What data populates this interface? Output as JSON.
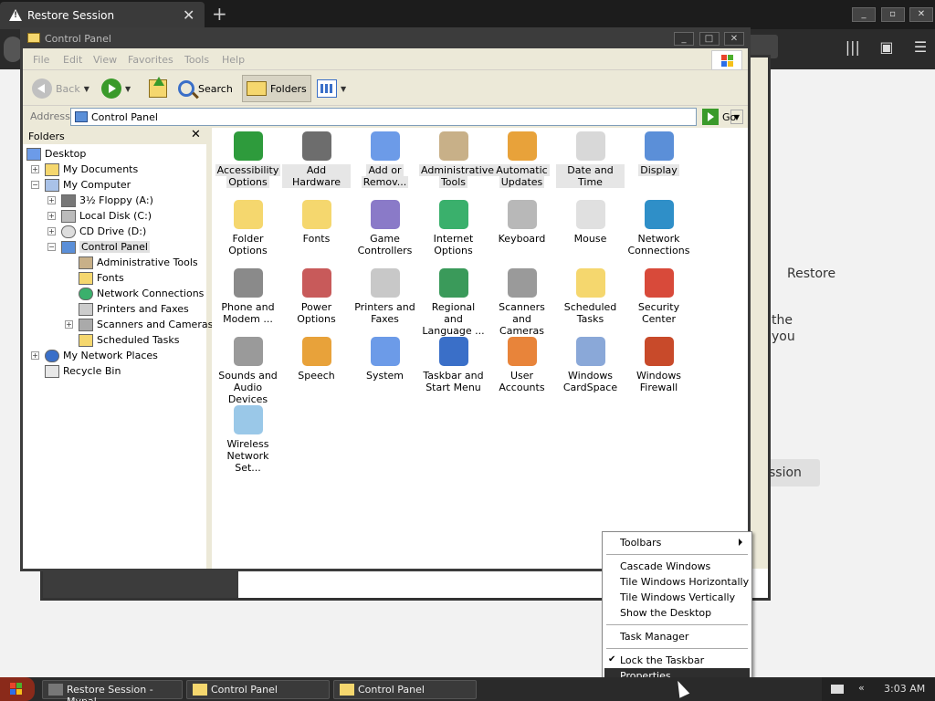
{
  "browser": {
    "tab_title": "Restore Session",
    "new_tab_symbol": "+",
    "close_symbol": "✕",
    "window_controls": [
      "_",
      "▫",
      "✕"
    ],
    "bg_text": [
      "Restore",
      "the",
      "you",
      "ssion"
    ]
  },
  "cp_back": {
    "title": "Control Panel"
  },
  "cp": {
    "title": "Control Panel",
    "title_buttons": [
      "_",
      "□",
      "✕"
    ],
    "menu": [
      "File",
      "Edit",
      "View",
      "Favorites",
      "Tools",
      "Help"
    ],
    "toolbar": {
      "back": "Back",
      "search": "Search",
      "folders": "Folders"
    },
    "address": {
      "label": "Address",
      "value": "Control Panel",
      "go": "Go"
    },
    "folders_pane": {
      "title": "Folders",
      "close": "✕",
      "tree": [
        {
          "label": "Desktop",
          "icon": "desktop-icon"
        },
        {
          "label": "My Documents",
          "icon": "my-documents-icon"
        },
        {
          "label": "My Computer",
          "icon": "my-computer-icon"
        },
        {
          "label": "3½ Floppy (A:)",
          "icon": "floppy-icon"
        },
        {
          "label": "Local Disk (C:)",
          "icon": "local-disk-icon"
        },
        {
          "label": "CD Drive (D:)",
          "icon": "cd-drive-icon"
        },
        {
          "label": "Control Panel",
          "icon": "control-panel-icon"
        },
        {
          "label": "Administrative Tools",
          "icon": "administrative-tools-icon"
        },
        {
          "label": "Fonts",
          "icon": "fonts-folder-icon"
        },
        {
          "label": "Network Connections",
          "icon": "network-connections-icon"
        },
        {
          "label": "Printers and Faxes",
          "icon": "printer-icon"
        },
        {
          "label": "Scanners and Cameras",
          "icon": "scanner-icon"
        },
        {
          "label": "Scheduled Tasks",
          "icon": "scheduled-tasks-icon"
        },
        {
          "label": "My Network Places",
          "icon": "network-places-icon"
        },
        {
          "label": "Recycle Bin",
          "icon": "recycle-bin-icon"
        }
      ]
    },
    "items": [
      {
        "label1": "Accessibility",
        "label2": "Options",
        "icon": "accessibility-icon",
        "color": "#2e9b3c"
      },
      {
        "label1": "Add Hardware",
        "label2": "",
        "icon": "add-hardware-icon",
        "color": "#6d6d6d"
      },
      {
        "label1": "Add or",
        "label2": "Remov...",
        "icon": "add-remove-programs-icon",
        "color": "#6c9be8"
      },
      {
        "label1": "Administrative",
        "label2": "Tools",
        "icon": "administrative-tools-icon",
        "color": "#c8b088"
      },
      {
        "label1": "Automatic",
        "label2": "Updates",
        "icon": "automatic-updates-icon",
        "color": "#e8a23a"
      },
      {
        "label1": "Date and Time",
        "label2": "",
        "icon": "date-time-icon",
        "color": "#d8d8d8"
      },
      {
        "label1": "Display",
        "label2": "",
        "icon": "display-icon",
        "color": "#5b8fd8"
      },
      {
        "label1": "Folder Options",
        "label2": "",
        "icon": "folder-options-icon",
        "color": "#f5d76e"
      },
      {
        "label1": "Fonts",
        "label2": "",
        "icon": "fonts-icon",
        "color": "#f5d76e"
      },
      {
        "label1": "Game",
        "label2": "Controllers",
        "icon": "game-controllers-icon",
        "color": "#8a7ac8"
      },
      {
        "label1": "Internet",
        "label2": "Options",
        "icon": "internet-options-icon",
        "color": "#3ab06c"
      },
      {
        "label1": "Keyboard",
        "label2": "",
        "icon": "keyboard-icon",
        "color": "#b8b8b8"
      },
      {
        "label1": "Mouse",
        "label2": "",
        "icon": "mouse-icon",
        "color": "#e0e0e0"
      },
      {
        "label1": "Network",
        "label2": "Connections",
        "icon": "network-connections-icon",
        "color": "#2f8fc8"
      },
      {
        "label1": "Phone and",
        "label2": "Modem ...",
        "icon": "phone-modem-icon",
        "color": "#8a8a8a"
      },
      {
        "label1": "Power Options",
        "label2": "",
        "icon": "power-options-icon",
        "color": "#c85a5a"
      },
      {
        "label1": "Printers and",
        "label2": "Faxes",
        "icon": "printers-faxes-icon",
        "color": "#c8c8c8"
      },
      {
        "label1": "Regional and",
        "label2": "Language ...",
        "icon": "regional-language-icon",
        "color": "#3a9a5a"
      },
      {
        "label1": "Scanners and",
        "label2": "Cameras",
        "icon": "scanners-cameras-icon",
        "color": "#9a9a9a"
      },
      {
        "label1": "Scheduled",
        "label2": "Tasks",
        "icon": "scheduled-tasks-icon",
        "color": "#f5d76e"
      },
      {
        "label1": "Security",
        "label2": "Center",
        "icon": "security-center-icon",
        "color": "#d84a3a"
      },
      {
        "label1": "Sounds and",
        "label2": "Audio Devices",
        "icon": "sounds-audio-icon",
        "color": "#9a9a9a"
      },
      {
        "label1": "Speech",
        "label2": "",
        "icon": "speech-icon",
        "color": "#e8a23a"
      },
      {
        "label1": "System",
        "label2": "",
        "icon": "system-icon",
        "color": "#6c9be8"
      },
      {
        "label1": "Taskbar and",
        "label2": "Start Menu",
        "icon": "taskbar-start-menu-icon",
        "color": "#3a6fc8"
      },
      {
        "label1": "User Accounts",
        "label2": "",
        "icon": "user-accounts-icon",
        "color": "#e8843a"
      },
      {
        "label1": "Windows",
        "label2": "CardSpace",
        "icon": "windows-cardspace-icon",
        "color": "#8aa8d8"
      },
      {
        "label1": "Windows",
        "label2": "Firewall",
        "icon": "windows-firewall-icon",
        "color": "#c84a2a"
      },
      {
        "label1": "Wireless",
        "label2": "Network Set...",
        "icon": "wireless-network-icon",
        "color": "#9ac8e8"
      }
    ]
  },
  "context_menu": {
    "items": [
      "Toolbars",
      "Cascade Windows",
      "Tile Windows Horizontally",
      "Tile Windows Vertically",
      "Show the Desktop",
      "Task Manager",
      "Lock the Taskbar",
      "Properties"
    ],
    "checkmark": "✔"
  },
  "taskbar": {
    "buttons": [
      "Restore Session - Mypal",
      "Control Panel",
      "Control Panel"
    ],
    "tray_chevron": "«",
    "clock": "3:03 AM"
  }
}
